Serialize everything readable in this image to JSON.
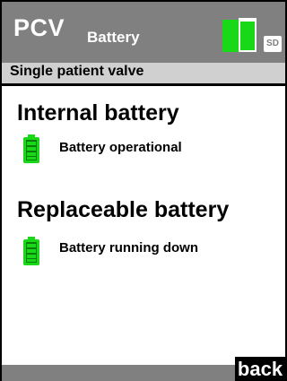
{
  "header": {
    "mode": "PCV",
    "screen_title": "Battery",
    "sd_label": "SD",
    "battery_icon": "battery-level-icon",
    "ok_color": "#18d818"
  },
  "subheader": {
    "valve_type": "Single patient valve"
  },
  "sections": [
    {
      "title": "Internal battery",
      "status_icon": "battery-full-icon",
      "status_text": "Battery operational"
    },
    {
      "title": "Replaceable battery",
      "status_icon": "battery-full-icon",
      "status_text": "Battery running down"
    }
  ],
  "footer": {
    "back_label": "back"
  }
}
